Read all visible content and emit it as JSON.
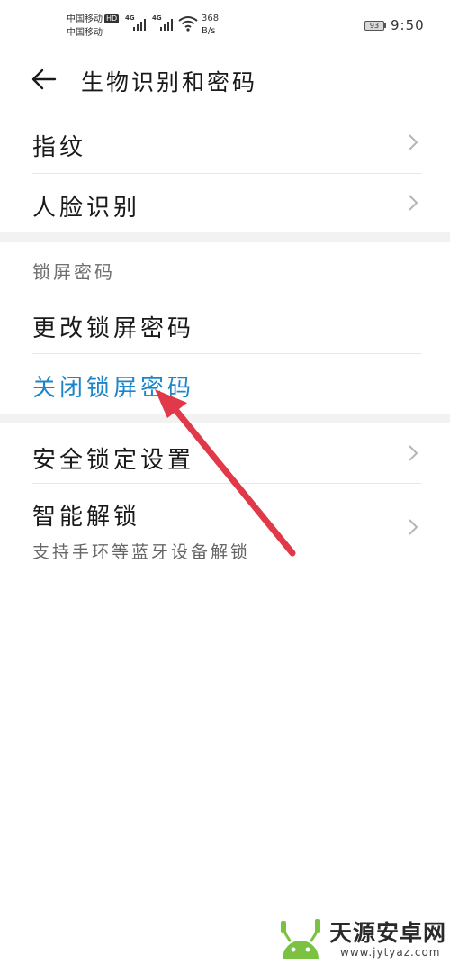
{
  "status_bar": {
    "carrier_1": "中国移动",
    "hd_badge": "HD",
    "carrier_2": "中国移动",
    "network_1": "4G",
    "network_2": "4G",
    "speed_value": "368",
    "speed_unit": "B/s",
    "battery": "93",
    "time": "9:50"
  },
  "header": {
    "title": "生物识别和密码"
  },
  "items": {
    "fingerprint": "指纹",
    "face": "人脸识别",
    "lock_section": "锁屏密码",
    "change_password": "更改锁屏密码",
    "close_password": "关闭锁屏密码",
    "security_lock": "安全锁定设置",
    "smart_unlock": "智能解锁",
    "smart_unlock_sub": "支持手环等蓝牙设备解锁"
  },
  "colors": {
    "accent": "#1d86c8",
    "annotation_arrow": "#e0394a",
    "divider": "#e6e6e6",
    "section_gap": "#f2f2f2"
  },
  "watermark": {
    "text": "天源安卓网",
    "url": "www.jytyaz.com"
  }
}
